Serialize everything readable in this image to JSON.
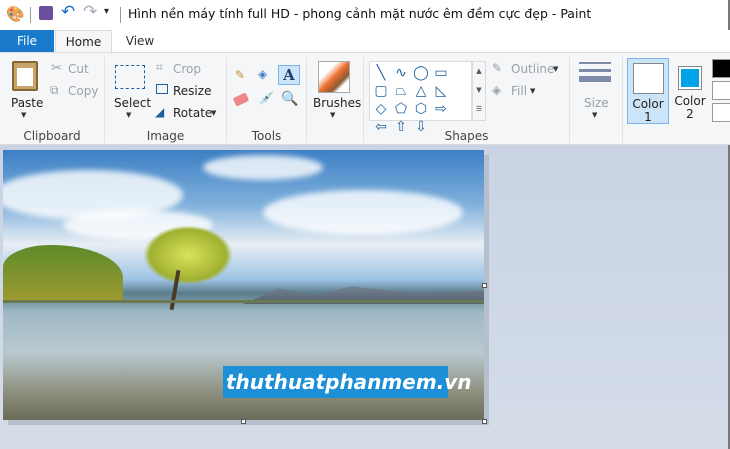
{
  "window": {
    "title": "Hình nền máy tính full HD - phong cảnh mặt nước êm đềm cực đẹp - Paint"
  },
  "tabs": [
    "File",
    "Home",
    "View"
  ],
  "clipboard": {
    "paste": "Paste",
    "cut": "Cut",
    "copy": "Copy",
    "group": "Clipboard"
  },
  "image": {
    "select": "Select",
    "crop": "Crop",
    "resize": "Resize",
    "rotate": "Rotate",
    "group": "Image"
  },
  "tools": {
    "group": "Tools",
    "text_glyph": "A"
  },
  "brushes": {
    "label": "Brushes"
  },
  "shapes": {
    "outline": "Outline",
    "fill": "Fill",
    "group": "Shapes",
    "glyphs": [
      "╲",
      "∿",
      "◯",
      "▭",
      "▢",
      "⏢",
      "△",
      "◺",
      "◇",
      "⬠",
      "⬡",
      "⇨",
      "⇦",
      "⇧",
      "⇩"
    ]
  },
  "size": {
    "label": "Size"
  },
  "colors": {
    "color1_label": "Color",
    "color1_num": "1",
    "color2_label": "Color",
    "color2_num": "2",
    "color1": "#ffffff",
    "color2": "#00a2e8",
    "palette": [
      "#000000",
      "#ffffff",
      "#ffffff"
    ]
  },
  "canvas": {
    "watermark": "thuthuatphanmem.vn"
  }
}
